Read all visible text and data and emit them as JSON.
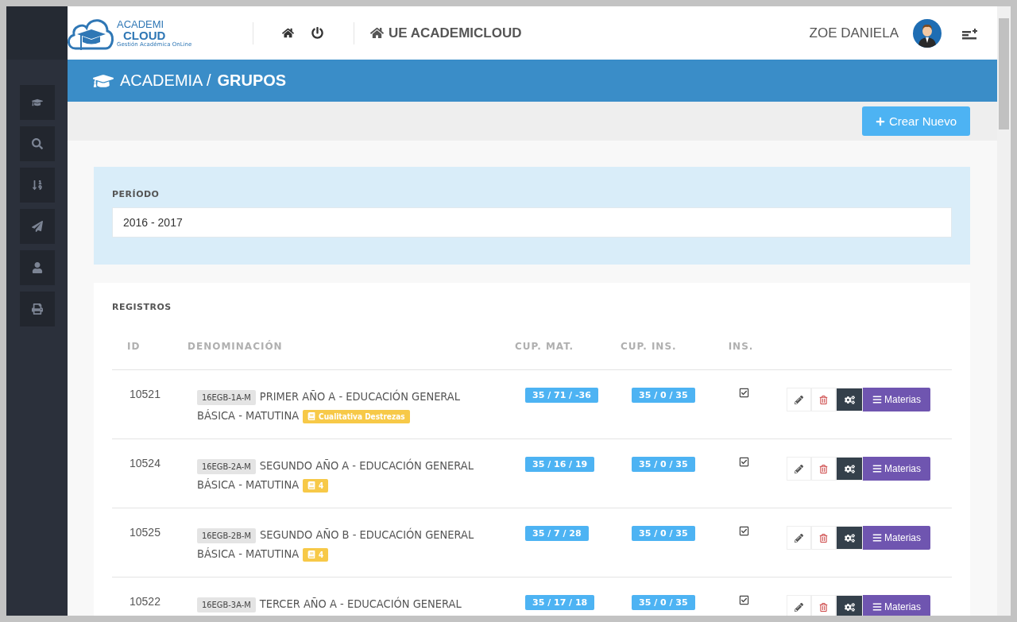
{
  "logo": {
    "line1": "ACADEMI",
    "line2": "CLOUD",
    "tagline": "Gestión Académica OnLine"
  },
  "header": {
    "institution": "UE ACADEMICLOUD",
    "user": "ZOE DANIELA"
  },
  "sidebar": {
    "items": [
      {
        "kind": "cap"
      },
      {
        "kind": "search"
      },
      {
        "kind": "sort"
      },
      {
        "kind": "send"
      },
      {
        "kind": "user"
      },
      {
        "kind": "print"
      }
    ]
  },
  "breadcrumb": {
    "section": "ACADEMIA /",
    "page": "GRUPOS"
  },
  "toolbar": {
    "create_button": "Crear Nuevo"
  },
  "filter": {
    "label": "PERÍODO",
    "value": "2016 - 2017"
  },
  "table": {
    "title": "REGISTROS",
    "columns": [
      "ID",
      "DENOMINACIÓN",
      "CUP. MAT.",
      "CUP. INS.",
      "INS."
    ],
    "rows": [
      {
        "id": "10521",
        "code": "16EGB-1A-M",
        "name": "PRIMER AÑO A - EDUCACIÓN GENERAL BÁSICA - MATUTINA",
        "tag": "Cualitativa Destrezas",
        "cup_mat": "35 / 71 / -36",
        "cup_ins": "35 / 0 / 35",
        "ins": true,
        "action": "Materias"
      },
      {
        "id": "10524",
        "code": "16EGB-2A-M",
        "name": "SEGUNDO AÑO A - EDUCACIÓN GENERAL BÁSICA - MATUTINA",
        "tag": "4",
        "cup_mat": "35 / 16 / 19",
        "cup_ins": "35 / 0 / 35",
        "ins": true,
        "action": "Materias"
      },
      {
        "id": "10525",
        "code": "16EGB-2B-M",
        "name": "SEGUNDO AÑO B - EDUCACIÓN GENERAL BÁSICA - MATUTINA",
        "tag": "4",
        "cup_mat": "35 / 7 / 28",
        "cup_ins": "35 / 0 / 35",
        "ins": true,
        "action": "Materias"
      },
      {
        "id": "10522",
        "code": "16EGB-3A-M",
        "name": "TERCER AÑO A - EDUCACIÓN GENERAL",
        "cup_mat": "35 / 17 / 18",
        "cup_ins": "35 / 0 / 35",
        "ins": true,
        "action": "Materias"
      }
    ]
  }
}
